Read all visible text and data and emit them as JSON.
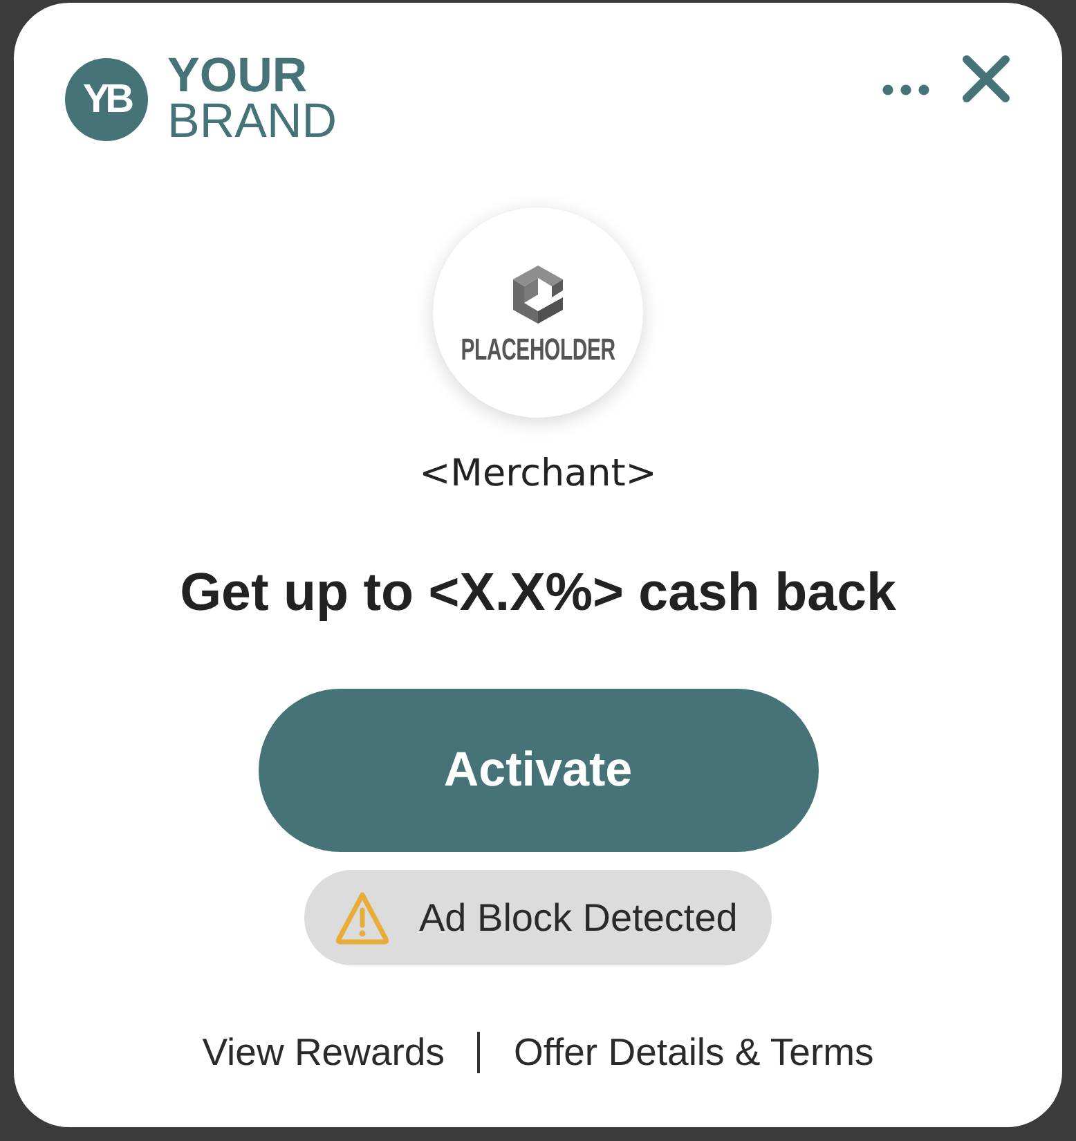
{
  "brand": {
    "monogram": "YB",
    "name_lines": [
      "YOUR",
      "BRAND"
    ]
  },
  "merchant": {
    "logo_text": "PLACEHOLDER",
    "name": "<Merchant>"
  },
  "offer": {
    "headline": "Get up to <X.X%> cash back"
  },
  "activate_button": {
    "label": "Activate"
  },
  "notice": {
    "kind": "warning",
    "message": "Ad Block Detected"
  },
  "footer_links": [
    {
      "label": "View Rewards"
    },
    {
      "label": "Offer Details & Terms"
    }
  ]
}
